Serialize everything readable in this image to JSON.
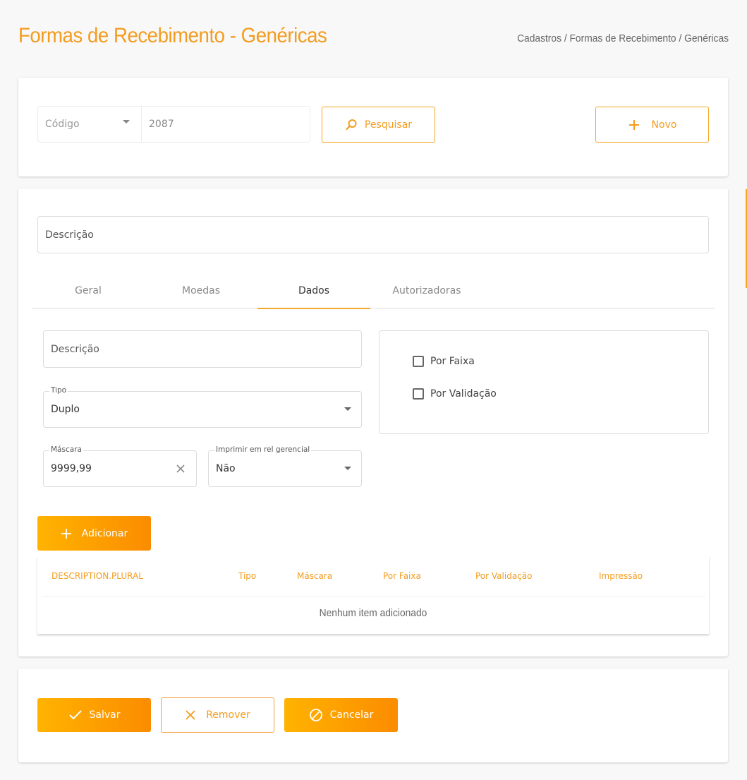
{
  "header": {
    "title": "Formas de Recebimento - Genéricas",
    "breadcrumb": [
      "Cadastros",
      "Formas de Recebimento",
      "Genéricas"
    ],
    "breadcrumb_sep": "/"
  },
  "search": {
    "field_select": "Código",
    "value": "2087",
    "search_label": "Pesquisar",
    "new_label": "Novo"
  },
  "form": {
    "descricao_placeholder": "Descrição",
    "tabs": [
      "Geral",
      "Moedas",
      "Dados",
      "Autorizadoras"
    ],
    "active_tab": "Dados",
    "dados": {
      "descricao_placeholder": "Descrição",
      "tipo_label": "Tipo",
      "tipo_value": "Duplo",
      "mascara_label": "Máscara",
      "mascara_value": "9999,99",
      "imprimir_label": "Imprimir em rel gerencial",
      "imprimir_value": "Não",
      "por_faixa_label": "Por Faixa",
      "por_faixa_checked": false,
      "por_validacao_label": "Por Validação",
      "por_validacao_checked": false,
      "add_label": "Adicionar"
    },
    "table": {
      "columns": [
        "DESCRIPTION.PLURAL",
        "Tipo",
        "Máscara",
        "Por Faixa",
        "Por Validação",
        "Impressão"
      ],
      "empty_message": "Nenhum item adicionado"
    }
  },
  "actions": {
    "save_label": "Salvar",
    "remove_label": "Remover",
    "cancel_label": "Cancelar"
  },
  "colors": {
    "accent": "#f39c1f",
    "button_gradient_start": "#ffb300",
    "button_gradient_end": "#fb8c00"
  }
}
